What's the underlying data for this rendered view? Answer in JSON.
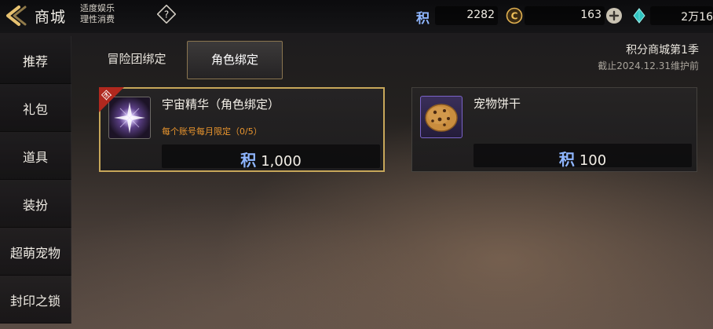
{
  "header": {
    "title": "商城",
    "advice_line1": "适度娱乐",
    "advice_line2": "理性消费",
    "currencies": [
      {
        "icon": "points-ji-icon",
        "symbol": "积",
        "value": "2282"
      },
      {
        "icon": "gold-coin-icon",
        "value": "163"
      },
      {
        "icon": "diamond-gem-icon",
        "value": "2万16"
      }
    ]
  },
  "sidebar": {
    "items": [
      {
        "label": "推荐"
      },
      {
        "label": "礼包"
      },
      {
        "label": "道具"
      },
      {
        "label": "装扮"
      },
      {
        "label": "超萌宠物"
      },
      {
        "label": "封印之锁"
      }
    ]
  },
  "tabs": [
    {
      "label": "冒险团绑定",
      "active": false
    },
    {
      "label": "角色绑定",
      "active": true
    }
  ],
  "season": {
    "title": "积分商城第1季",
    "deadline": "截止2024.12.31维护前"
  },
  "items": [
    {
      "name": "宇宙精华（角色绑定）",
      "badge": "团",
      "limit": "每个账号每月限定（0/5）",
      "price_symbol": "积",
      "price": "1,000",
      "icon": "cosmic-essence-icon",
      "selected": true
    },
    {
      "name": "宠物饼干",
      "price_symbol": "积",
      "price": "100",
      "icon": "cookie-icon",
      "selected": false
    }
  ],
  "colors": {
    "accent_gold": "#c7a75a",
    "limit_orange": "#e8942e",
    "points_blue": "#8fb6ff"
  }
}
